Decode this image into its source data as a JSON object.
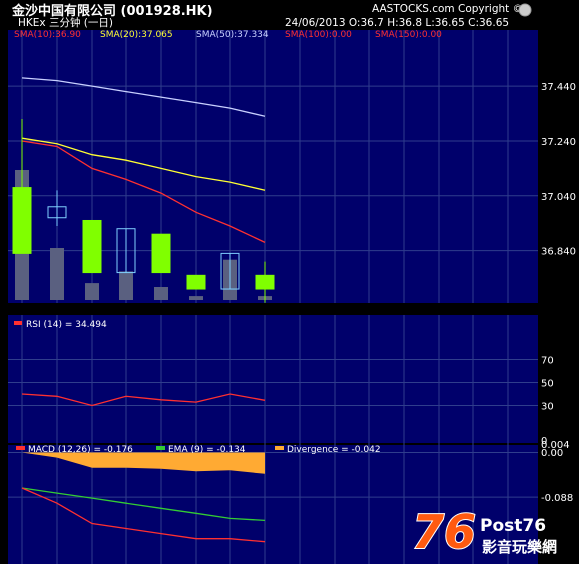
{
  "header": {
    "stock_title": "金沙中国有限公司 (001928.HK)",
    "copyright": "AASTOCKS.com Copyright ©",
    "subtitle": "HKEx 三分钟 (一日)",
    "ohlc": "24/06/2013  O:36.7  H:36.8  L:36.65  C:36.65"
  },
  "colors": {
    "background": "#000000",
    "panel": "#00006b",
    "grid": "#2f3d8c",
    "sma10": "#ff3030",
    "sma20": "#ffff33",
    "sma50": "#c8d0ff",
    "up_candle": "#80ff00",
    "down_candle_border": "#7fd0ff",
    "volume": "#5a6080",
    "rsi": "#ff3030",
    "macd": "#ff3030",
    "ema": "#33cc33",
    "divergence": "#ffaa33"
  },
  "chart_data": [
    {
      "type": "candlestick",
      "legend": [
        {
          "label": "SMA(10):36.90",
          "color": "#ff3030"
        },
        {
          "label": "SMA(20):37.065",
          "color": "#ffff33"
        },
        {
          "label": "SMA(50):37.334",
          "color": "#c8d0ff"
        },
        {
          "label": "SMA(100):0.00",
          "color": "#ff3030"
        },
        {
          "label": "SMA(150):0.00",
          "color": "#ff3030"
        }
      ],
      "y_ticks": [
        "37.440",
        "37.240",
        "37.040",
        "36.840"
      ],
      "ylim": [
        36.66,
        37.59
      ],
      "candles": [
        {
          "open": 36.83,
          "high": 37.32,
          "low": 36.83,
          "close": 37.07
        },
        {
          "open": 37.0,
          "high": 37.06,
          "low": 36.93,
          "close": 36.96
        },
        {
          "open": 36.76,
          "high": 36.95,
          "low": 36.76,
          "close": 36.95
        },
        {
          "open": 36.92,
          "high": 36.92,
          "low": 36.76,
          "close": 36.76
        },
        {
          "open": 36.76,
          "high": 36.9,
          "low": 36.76,
          "close": 36.9
        },
        {
          "open": 36.7,
          "high": 36.75,
          "low": 36.7,
          "close": 36.75
        },
        {
          "open": 36.83,
          "high": 36.83,
          "low": 36.7,
          "close": 36.7
        },
        {
          "open": 36.7,
          "high": 36.8,
          "low": 36.65,
          "close": 36.75
        }
      ],
      "volume": [
        1.0,
        0.4,
        0.13,
        0.22,
        0.1,
        0.03,
        0.31,
        0.03
      ],
      "sma10": [
        37.24,
        37.22,
        37.14,
        37.1,
        37.05,
        36.98,
        36.93,
        36.87
      ],
      "sma20": [
        37.25,
        37.23,
        37.19,
        37.17,
        37.14,
        37.11,
        37.09,
        37.06
      ],
      "sma50": [
        37.47,
        37.46,
        37.44,
        37.42,
        37.4,
        37.38,
        37.36,
        37.33
      ]
    },
    {
      "type": "line",
      "legend": "RSI (14)  = 34.494",
      "y_ticks": [
        "70",
        "50",
        "30",
        "0"
      ],
      "ylim": [
        0,
        100
      ],
      "values": [
        40,
        38,
        30,
        38,
        35,
        33,
        40,
        34.494
      ]
    },
    {
      "type": "area",
      "legend": [
        {
          "label": "MACD (12,26) = -0.176",
          "color": "#ff3030"
        },
        {
          "label": "EMA (9) = -0.134",
          "color": "#33cc33"
        },
        {
          "label": "Divergence = -0.042",
          "color": "#ffaa33"
        }
      ],
      "y_ticks": [
        "0.004",
        "0.00",
        "-0.088"
      ],
      "ylim": [
        -0.22,
        0.005
      ],
      "macd": [
        -0.07,
        -0.1,
        -0.14,
        -0.15,
        -0.16,
        -0.17,
        -0.17,
        -0.176
      ],
      "ema": [
        -0.07,
        -0.08,
        -0.09,
        -0.1,
        -0.11,
        -0.12,
        -0.13,
        -0.134
      ],
      "divergence": [
        0,
        -0.01,
        -0.03,
        -0.03,
        -0.032,
        -0.037,
        -0.035,
        -0.042
      ]
    }
  ],
  "watermark": {
    "number": "76",
    "brand": "Post76",
    "chinese": "影音玩樂網"
  }
}
